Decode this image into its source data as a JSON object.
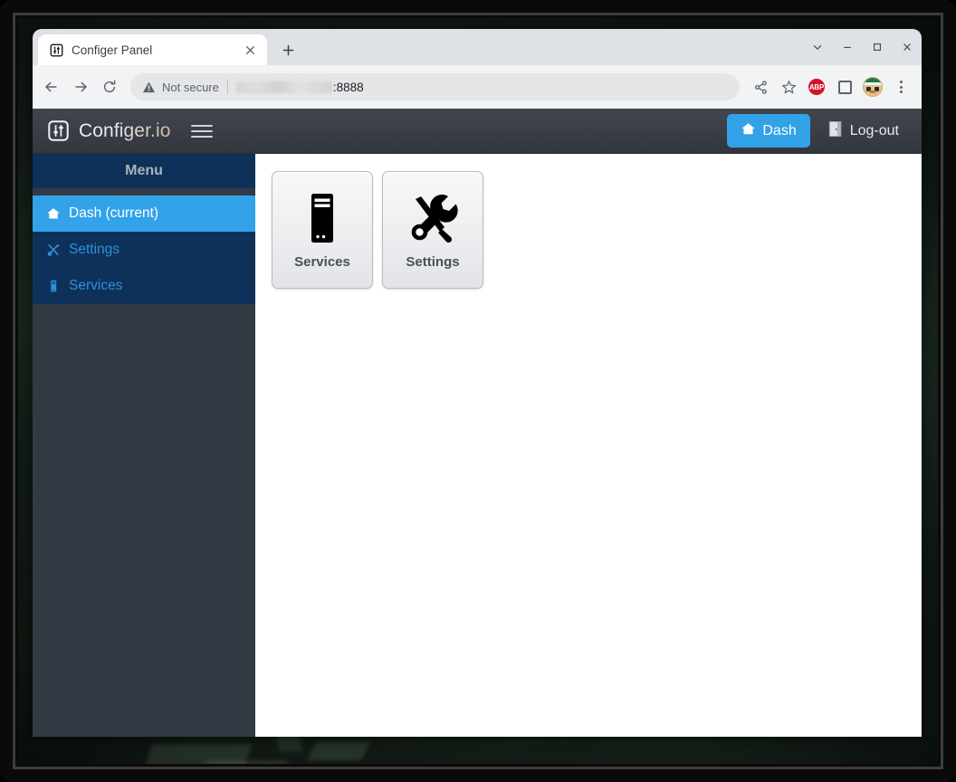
{
  "browser": {
    "tab": {
      "title": "Configer Panel",
      "favicon_icon": "sliders-icon",
      "close_icon": "close-icon"
    },
    "new_tab_label": "+",
    "window_controls": [
      {
        "name": "tab-search",
        "icon": "chevron-down-icon"
      },
      {
        "name": "minimize",
        "icon": "minimize-icon"
      },
      {
        "name": "maximize",
        "icon": "maximize-icon"
      },
      {
        "name": "close",
        "icon": "close-icon"
      }
    ],
    "toolbar": {
      "back_icon": "back-arrow-icon",
      "forward_icon": "forward-arrow-icon",
      "reload_icon": "reload-icon",
      "security_label": "Not secure",
      "security_icon": "warning-triangle-icon",
      "url_redacted": "",
      "url_port": ":8888",
      "share_icon": "share-icon",
      "bookmark_icon": "star-icon",
      "extensions": [
        {
          "name": "adblock-plus",
          "label": "ABP"
        },
        {
          "name": "extension-square",
          "label": ""
        }
      ],
      "profile_icon": "avatar-icon",
      "menu_icon": "kebab-menu-icon"
    }
  },
  "app": {
    "navbar": {
      "logo_icon": "sliders-logo-icon",
      "brand": "Configer.io",
      "hamburger_icon": "hamburger-icon",
      "dash_button": {
        "label": "Dash",
        "icon": "home-icon",
        "color": "#31a2e8"
      },
      "logout_button": {
        "label": "Log-out",
        "icon": "door-icon"
      }
    },
    "sidebar": {
      "header": "Menu",
      "items": [
        {
          "label": "Dash (current)",
          "icon": "home-icon",
          "active": true
        },
        {
          "label": "Settings",
          "icon": "tools-icon",
          "active": false
        },
        {
          "label": "Services",
          "icon": "server-icon",
          "active": false
        }
      ]
    },
    "content": {
      "cards": [
        {
          "label": "Services",
          "icon": "server-tower-icon"
        },
        {
          "label": "Settings",
          "icon": "wrench-screwdriver-icon"
        }
      ]
    }
  }
}
